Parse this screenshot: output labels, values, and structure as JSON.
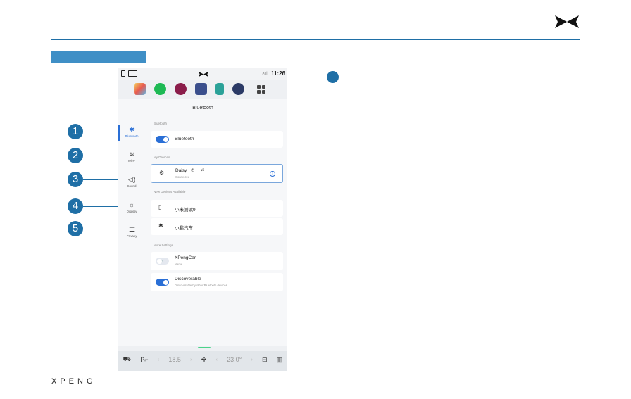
{
  "brand": {
    "wordmark": "XPENG",
    "logo_icon": "xpeng-x-icon",
    "accent": "#1f6fa6"
  },
  "callouts": [
    "1",
    "2",
    "3",
    "4",
    "5"
  ],
  "screen": {
    "status_bar": {
      "time": "11:26",
      "signal_icon": "signal-icon"
    },
    "apps": [
      "maps-app-icon",
      "spotify-app-icon",
      "music-app-icon",
      "radio-app-icon",
      "phone-app-icon",
      "camera-app-icon",
      "apps-grid-icon"
    ],
    "page_title": "Bluetooth",
    "sidebar": [
      {
        "label": "Bluetooth",
        "icon": "bluetooth-icon",
        "glyph": "✱",
        "active": true
      },
      {
        "label": "Wi-Fi",
        "icon": "wifi-icon",
        "glyph": "≋",
        "active": false
      },
      {
        "label": "Sound",
        "icon": "speaker-icon",
        "glyph": "◁)",
        "active": false
      },
      {
        "label": "Display",
        "icon": "sun-icon",
        "glyph": "☼",
        "active": false
      },
      {
        "label": "Privacy",
        "icon": "document-icon",
        "glyph": "☰",
        "active": false
      }
    ],
    "sections": {
      "bluetooth": "Bluetooth",
      "my_devices": "My Devices",
      "available": "New Devices Available",
      "more": "More Settings"
    },
    "bluetooth_toggle": {
      "label": "Bluetooth",
      "on": true
    },
    "my_device": {
      "name": "Daisy",
      "status": "Connected",
      "phone_glyph": "✆",
      "audio_glyph": "♫",
      "info_glyph": "i"
    },
    "available_devices": [
      {
        "name": "小米测试9",
        "icon": "phone-device-icon",
        "glyph": "▯"
      },
      {
        "name": "小鹏汽车",
        "icon": "bluetooth-device-icon",
        "glyph": "✱"
      }
    ],
    "more_settings": {
      "car_name": {
        "title": "XPengCar",
        "subtitle": "Name",
        "badge": "OFF"
      },
      "discoverable": {
        "title": "Discoverable",
        "subtitle": "Discoverable by other Bluetooth devices",
        "on": true
      }
    },
    "bottom_bar": {
      "left_temp": "18.5",
      "right_temp": "23.0°",
      "fan_label": "",
      "car_glyph": "⛟",
      "seat_glyph": "P⌐",
      "fan_glyph": "✤",
      "defrost_front_glyph": "⊟",
      "defrost_rear_glyph": "▥"
    }
  }
}
